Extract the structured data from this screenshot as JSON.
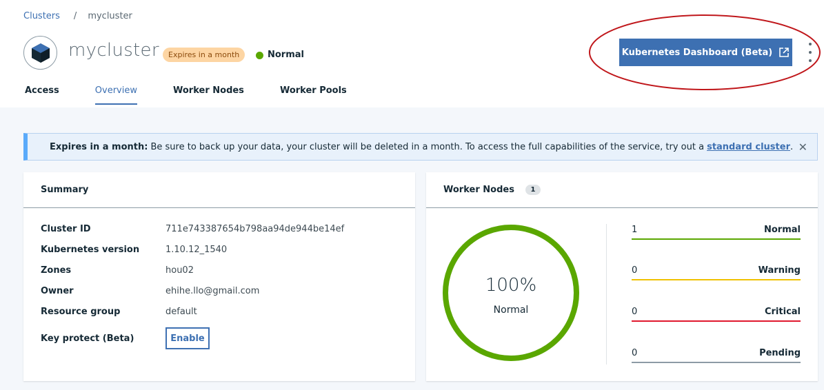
{
  "breadcrumb": {
    "root": "Clusters",
    "separator": "/",
    "current": "mycluster"
  },
  "cluster": {
    "logo_icon": "kubernetes-cube-icon",
    "name": "mycluster",
    "expires_badge": "Expires in a month",
    "status": "Normal",
    "status_color": "#5aa700"
  },
  "actions": {
    "dashboard_label": "Kubernetes Dashboard (Beta)",
    "dashboard_icon": "launch-icon",
    "overflow_icon": "overflow-menu-vertical-icon"
  },
  "tabs": [
    {
      "label": "Access",
      "active": false
    },
    {
      "label": "Overview",
      "active": true
    },
    {
      "label": "Worker Nodes",
      "active": false
    },
    {
      "label": "Worker Pools",
      "active": false
    }
  ],
  "banner": {
    "title": "Expires in a month:",
    "message": "Be sure to back up your data, your cluster will be deleted in a month. To access the full capabilities of the service, try out a",
    "link_text": "standard cluster",
    "suffix": ".",
    "close_icon": "close-icon"
  },
  "summary": {
    "title": "Summary",
    "rows": [
      {
        "label": "Cluster ID",
        "value": "711e743387654b798aa94de944be14ef"
      },
      {
        "label": "Kubernetes version",
        "value": "1.10.12_1540"
      },
      {
        "label": "Zones",
        "value": "hou02"
      },
      {
        "label": "Owner",
        "value": "ehihe.llo@gmail.com"
      },
      {
        "label": "Resource group",
        "value": "default"
      }
    ],
    "key_protect_label": "Key protect (Beta)",
    "enable_label": "Enable"
  },
  "worker_nodes": {
    "title": "Worker Nodes",
    "count": "1",
    "donut_percent": "100%",
    "donut_label": "Normal",
    "donut_fraction": 1.0,
    "donut_color": "#5aa700",
    "stats": [
      {
        "count": "1",
        "name": "Normal",
        "color": "#5aa700"
      },
      {
        "count": "0",
        "name": "Warning",
        "color": "#efc100"
      },
      {
        "count": "0",
        "name": "Critical",
        "color": "#e0182d"
      },
      {
        "count": "0",
        "name": "Pending",
        "color": "#8c9ba5"
      }
    ]
  },
  "colors": {
    "accent": "#3d70b2",
    "annotation": "#c0171b"
  }
}
